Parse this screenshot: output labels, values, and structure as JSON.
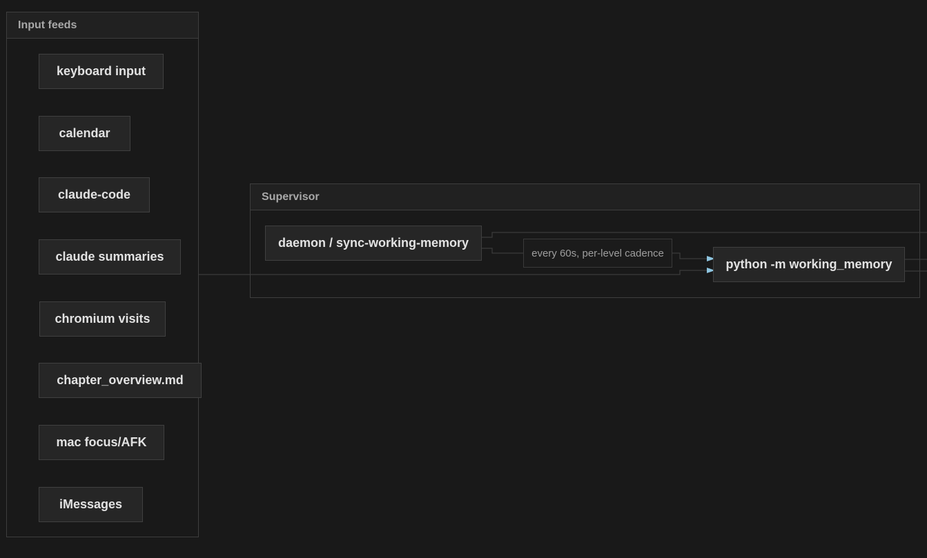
{
  "groups": {
    "input_feeds": {
      "title": "Input feeds"
    },
    "supervisor": {
      "title": "Supervisor"
    }
  },
  "input_feeds": [
    {
      "id": "keyboard",
      "label": "keyboard input"
    },
    {
      "id": "calendar",
      "label": "calendar"
    },
    {
      "id": "claude-code",
      "label": "claude-code"
    },
    {
      "id": "claude-summaries",
      "label": "claude summaries"
    },
    {
      "id": "chromium-visits",
      "label": "chromium visits"
    },
    {
      "id": "chapter-overview",
      "label": "chapter_overview.md"
    },
    {
      "id": "mac-focus",
      "label": "mac focus/AFK"
    },
    {
      "id": "imessages",
      "label": "iMessages"
    }
  ],
  "supervisor_nodes": {
    "daemon": {
      "label": "daemon / sync-working-memory"
    },
    "python": {
      "label": "python -m working_memory"
    }
  },
  "edge_labels": {
    "daemon_to_python": "every 60s, per-level cadence"
  },
  "colors": {
    "background": "#191919",
    "node_fill": "#262626",
    "node_border": "#404040",
    "group_border": "#3e3e3e",
    "edge_line": "#3c3c3c",
    "arrow_head": "#8ec5e0",
    "text": "#e2e2e2",
    "muted_text": "#a8a8a8"
  }
}
